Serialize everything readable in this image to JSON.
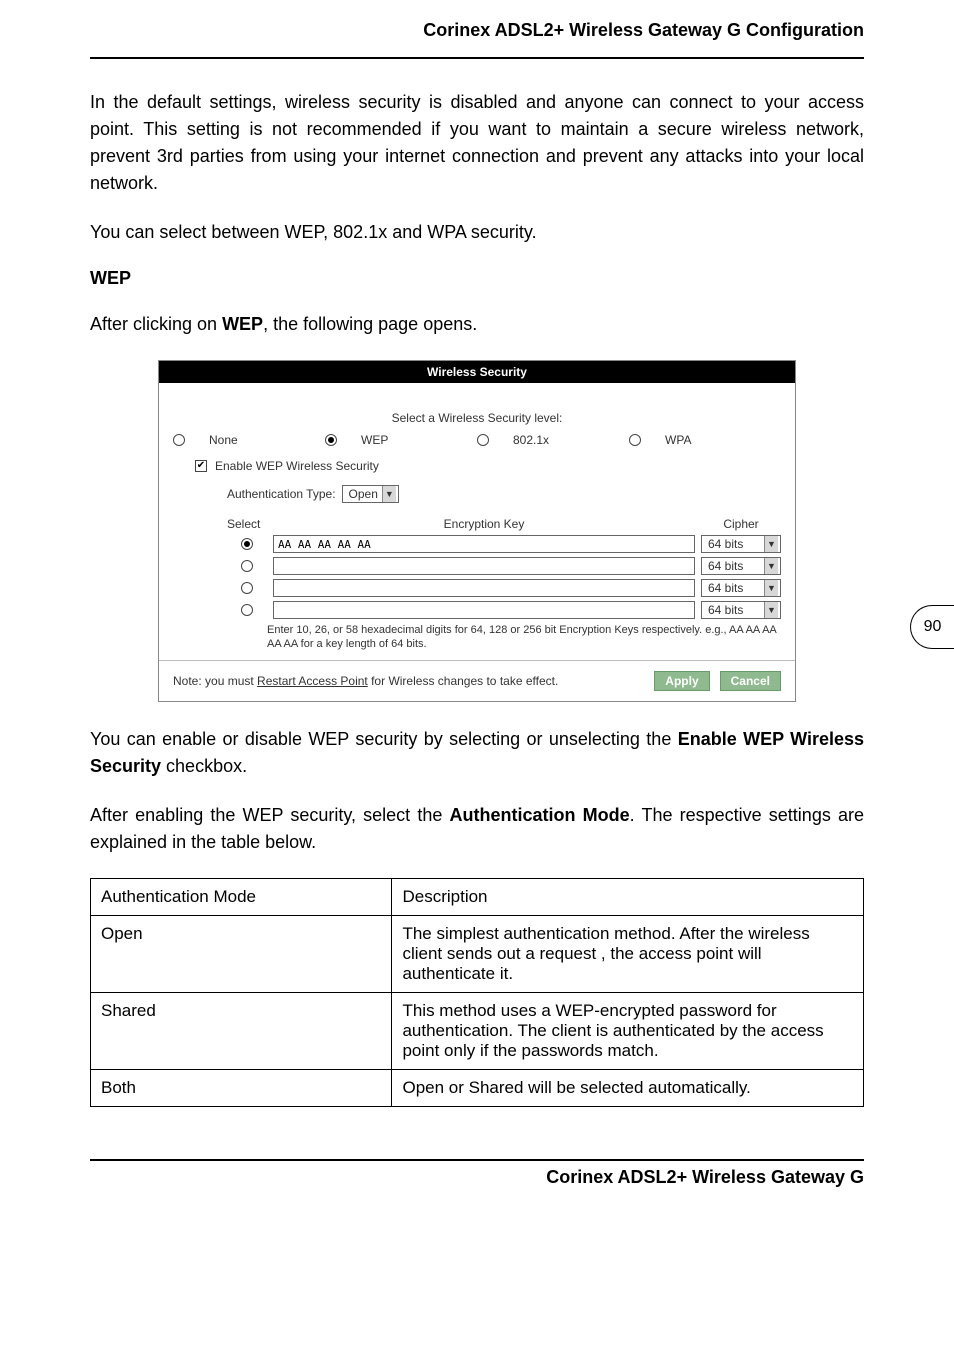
{
  "header": {
    "title": "Corinex ADSL2+ Wireless Gateway G Configuration"
  },
  "footer": {
    "title": "Corinex ADSL2+ Wireless Gateway G"
  },
  "page_number": "90",
  "paragraphs": {
    "p1": "In the default settings, wireless security is disabled and anyone can connect to your access point. This setting is not recommended if you want to maintain a secure wireless network, prevent 3rd parties from using your internet connection and prevent any attacks into your local network.",
    "p2": "You can select between WEP, 802.1x and WPA security.",
    "p3_pre": "After clicking on ",
    "p3_bold": "WEP",
    "p3_post": ", the following page opens.",
    "p4_pre": "You can enable or disable WEP security by selecting or unselecting the ",
    "p4_bold": "Enable WEP Wireless Security",
    "p4_post": " checkbox.",
    "p5_pre": "After enabling the WEP security, select the ",
    "p5_bold": "Authentication Mode",
    "p5_post": ". The respective settings are explained in the table below."
  },
  "section": {
    "wep": "WEP"
  },
  "panel": {
    "title": "Wireless Security",
    "select_level": "Select a Wireless Security level:",
    "radios": {
      "none": "None",
      "wep": "WEP",
      "x8021": "802.1x",
      "wpa": "WPA"
    },
    "enable_label": "Enable WEP Wireless Security",
    "auth_type_label": "Authentication Type:",
    "auth_type_value": "Open",
    "columns": {
      "select": "Select",
      "key": "Encryption Key",
      "cipher": "Cipher"
    },
    "keys": [
      {
        "selected": true,
        "value": "AA AA AA AA AA",
        "cipher": "64 bits"
      },
      {
        "selected": false,
        "value": "",
        "cipher": "64 bits"
      },
      {
        "selected": false,
        "value": "",
        "cipher": "64 bits"
      },
      {
        "selected": false,
        "value": "",
        "cipher": "64 bits"
      }
    ],
    "help": "Enter 10, 26, or 58 hexadecimal digits for 64, 128 or 256 bit Encryption Keys respectively. e.g., AA AA AA AA AA for a key length of 64 bits.",
    "note_pre": "Note: you must ",
    "note_link": "Restart Access Point",
    "note_post": " for Wireless changes to take effect.",
    "apply": "Apply",
    "cancel": "Cancel"
  },
  "table": {
    "head": {
      "c1": "Authentication Mode",
      "c2": "Description"
    },
    "rows": [
      {
        "c1": "Open",
        "c2": "The simplest authentication method. After the wireless client sends out a request , the access point will authenticate it."
      },
      {
        "c1": "Shared",
        "c2": "This method uses a WEP-encrypted password for authentication. The client is authenticated by the access point only if the passwords match."
      },
      {
        "c1": "Both",
        "c2": "Open or Shared will be selected automatically."
      }
    ]
  }
}
